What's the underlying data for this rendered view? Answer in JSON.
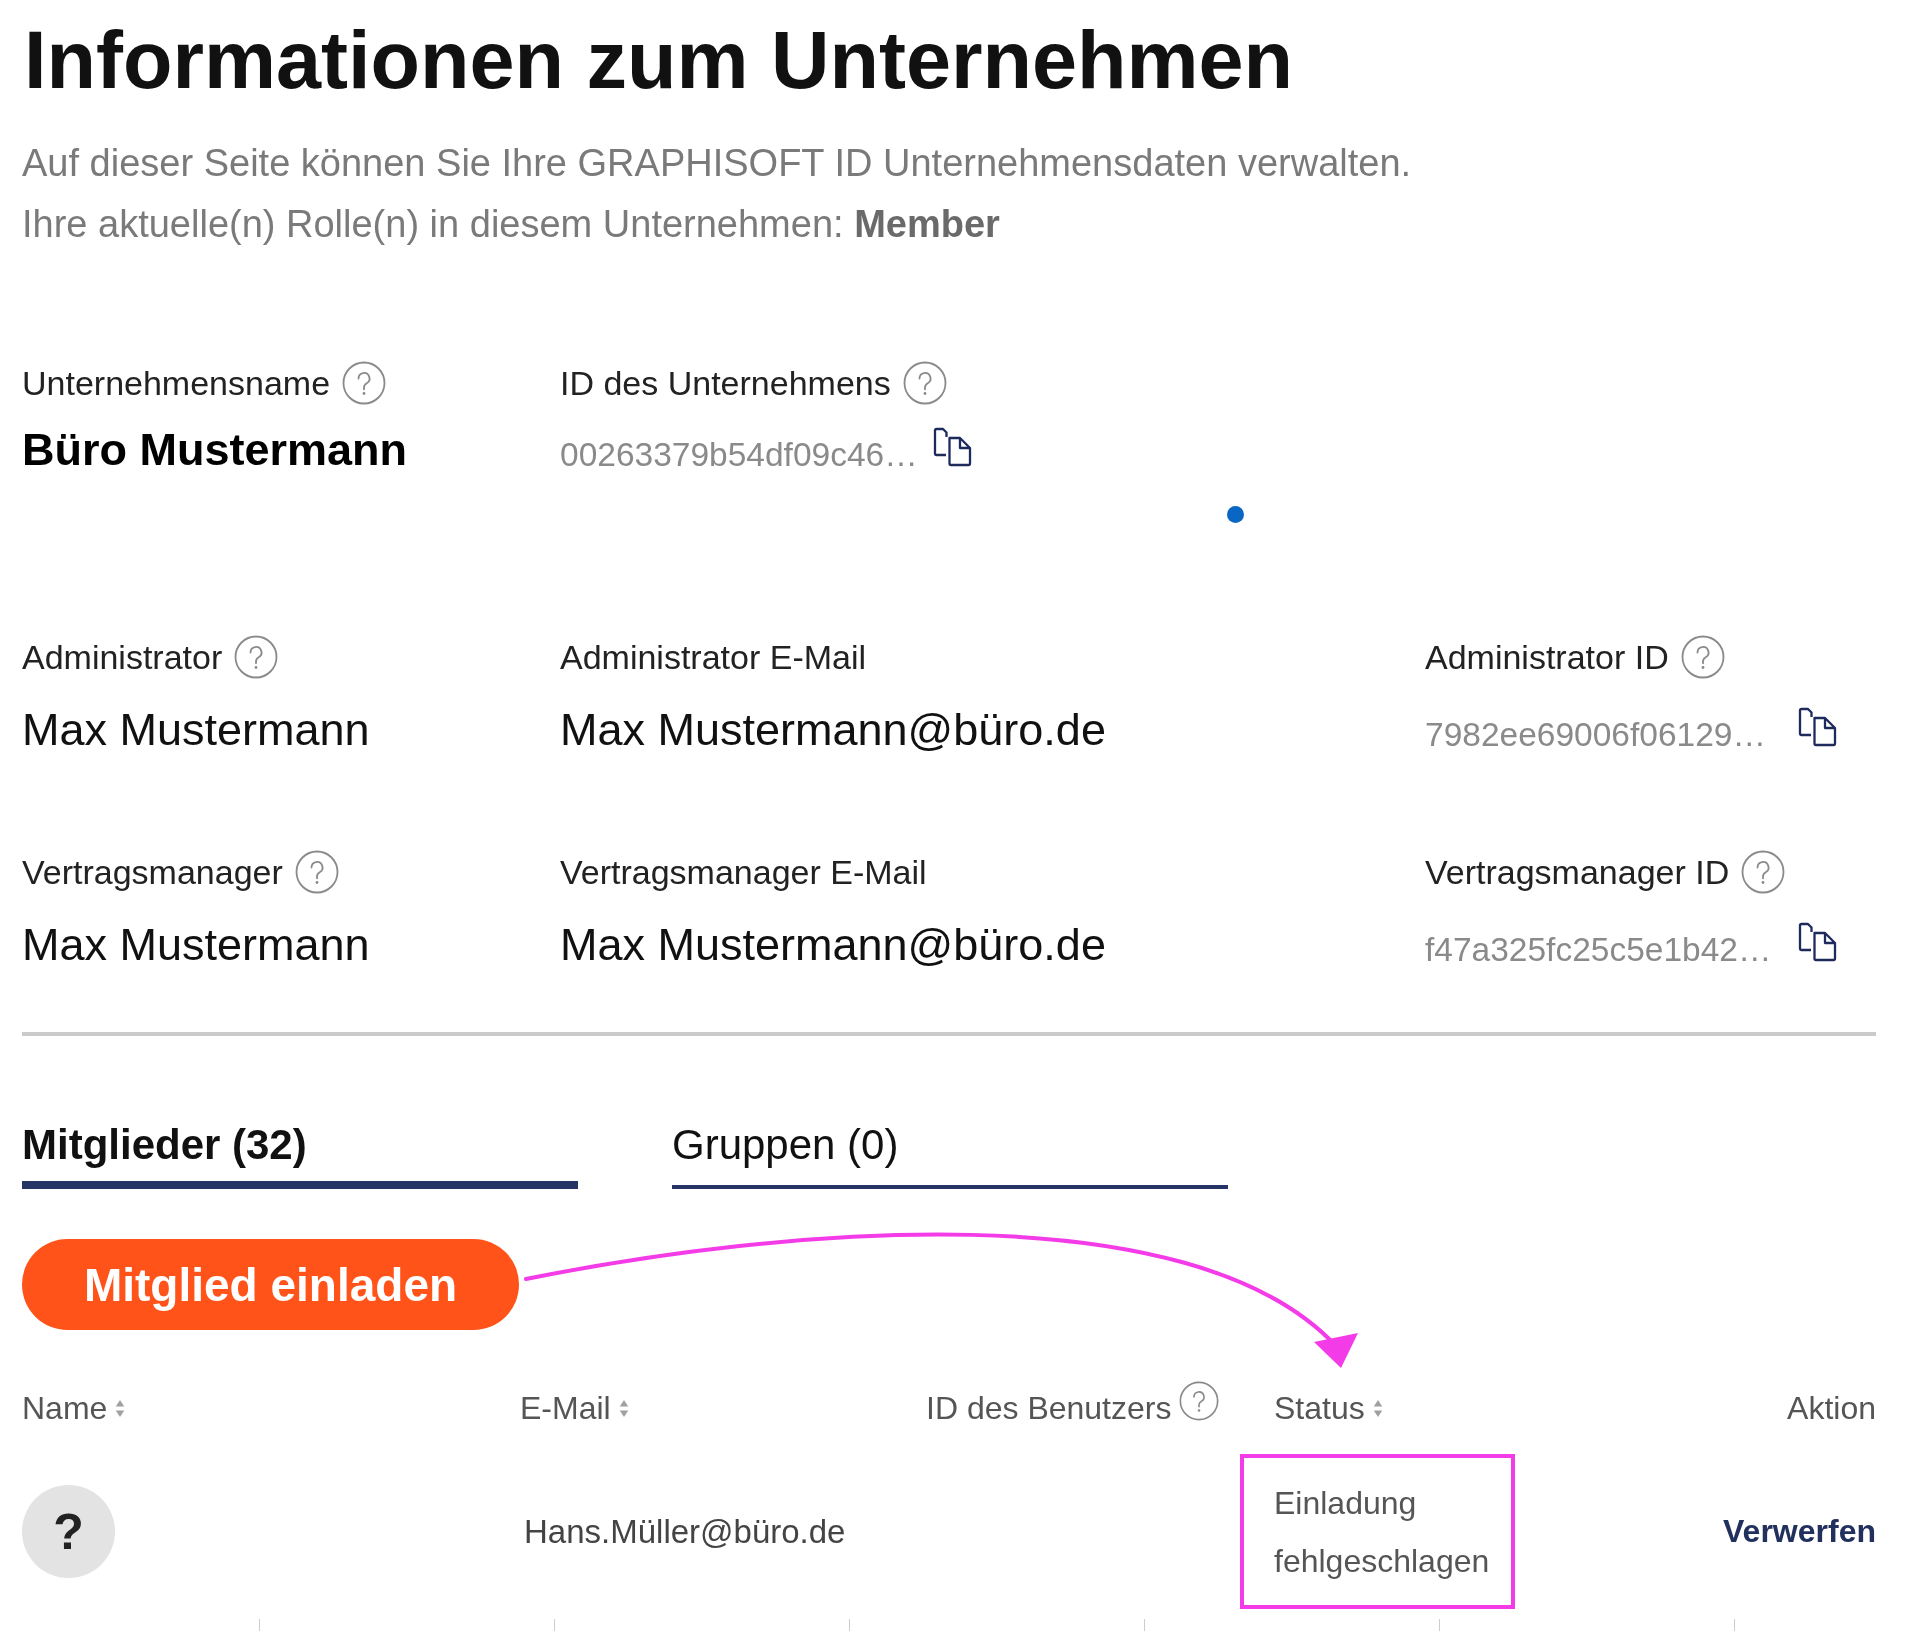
{
  "page": {
    "title": "Informationen zum Unternehmen",
    "intro": [
      "Auf dieser Seite können Sie Ihre GRAPHISOFT ID Unternehmensdaten verwalten.",
      "Ihre aktuelle(n) Rolle(n) in diesem Unternehmen: **Member**"
    ]
  },
  "company": [
    {
      "label": "Unternehmensname",
      "help": true,
      "kind": "name",
      "value": "Büro Mustermann"
    },
    {
      "label": "ID des Unternehmens",
      "help": true,
      "kind": "id",
      "value": "00263379b54df09c46…"
    }
  ],
  "contacts": [
    [
      {
        "label": "Administrator",
        "help": true,
        "kind": "text",
        "value": "Max Mustermann"
      },
      {
        "label": "Administrator E-Mail",
        "help": false,
        "kind": "text",
        "value": "Max Mustermann@büro.de"
      },
      {
        "label": "Administrator ID",
        "help": true,
        "kind": "id",
        "value": "7982ee69006f06129…"
      }
    ],
    [
      {
        "label": "Vertragsmanager",
        "help": true,
        "kind": "text",
        "value": "Max Mustermann"
      },
      {
        "label": "Vertragsmanager E-Mail",
        "help": false,
        "kind": "text",
        "value": "Max Mustermann@büro.de"
      },
      {
        "label": "Vertragsmanager ID",
        "help": true,
        "kind": "id",
        "value": "f47a325fc25c5e1b42…"
      }
    ]
  ],
  "tabs": [
    {
      "label": "Mitglieder (32)",
      "selected": true
    },
    {
      "label": "Gruppen (0)",
      "selected": false
    }
  ],
  "invite_button": {
    "label": "Mitglied einladen"
  },
  "table": {
    "columns": [
      {
        "label": "Name",
        "sortable": true,
        "help": false
      },
      {
        "label": "E-Mail",
        "sortable": true,
        "help": false
      },
      {
        "label": "ID des Benutzers",
        "sortable": false,
        "help": true
      },
      {
        "label": "Status",
        "sortable": true,
        "help": false
      },
      {
        "label": "Aktion",
        "sortable": false,
        "help": false
      }
    ],
    "rows": [
      {
        "avatar": "?",
        "email": "Hans.Müller@büro.de",
        "status": "Einladung fehlgeschlagen",
        "action": "Verwerfen"
      }
    ]
  }
}
